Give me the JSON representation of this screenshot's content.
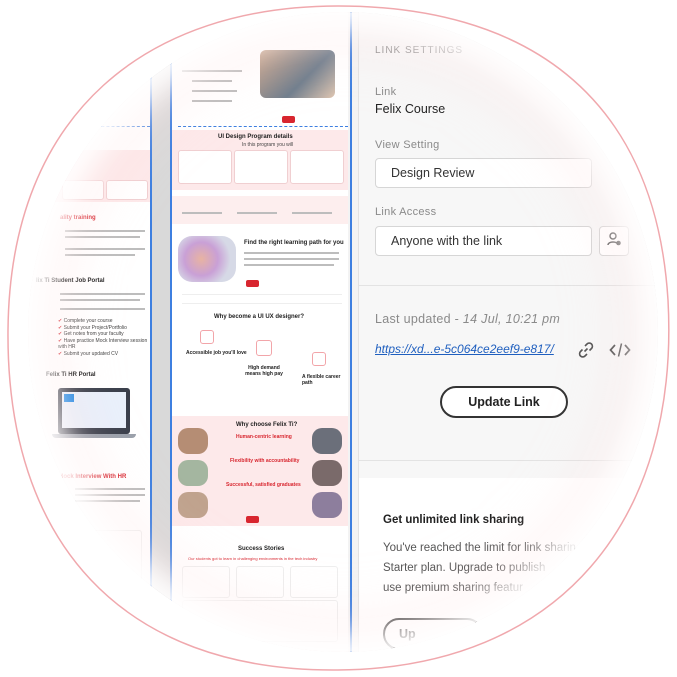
{
  "panel": {
    "section_title": "LINK SETTINGS",
    "link_label": "Link",
    "link_value": "Felix Course",
    "view_label": "View Setting",
    "view_value": "Design Review",
    "access_label": "Link Access",
    "access_value": "Anyone with the link",
    "updated_label": "Last updated",
    "updated_value": "14 Jul, 10:21 pm",
    "url": "https://xd...e-5c064ce2eef9-e817/",
    "update_button": "Update Link",
    "promo_title": "Get unlimited link sharing",
    "promo_line1": "You've reached the limit for link sharin",
    "promo_line2": "Starter plan. Upgrade to publish",
    "promo_line3": "use premium sharing featur",
    "promo_button": "Up"
  },
  "preview_left": {
    "heading_quality": "ality training",
    "heading_portal": "lix Ti Student Job Portal",
    "checklist": [
      "Complete your course",
      "Submit your Project/Portfolio",
      "Get notes from your faculty",
      "Have practice Mock Interview session with HR",
      "Submit your updated CV"
    ],
    "heading_hr": "Felix Ti HR Portal",
    "heading_mock": "se Mock Interview With HR"
  },
  "preview_mid": {
    "program_title": "UI Design Program details",
    "program_sub": "In this program you will",
    "learning_title": "Find the right learning path for you",
    "why_title": "Why become a UI UX designer?",
    "why_items": [
      "Accessible job you'll love",
      "High demand means high pay",
      "A flexible career path"
    ],
    "choose_title": "Why choose Felix Ti?",
    "choose_items": [
      "Human-centric learning",
      "Flexibility with accountability",
      "Successful, satisfied graduates"
    ],
    "stories_title": "Success Stories",
    "stories_sub": "Our students got to learn in challenging environments in the tech industry"
  },
  "colors": {
    "accent": "#d8262f",
    "link": "#1f5fbf",
    "divider": "#3d7fe0"
  }
}
